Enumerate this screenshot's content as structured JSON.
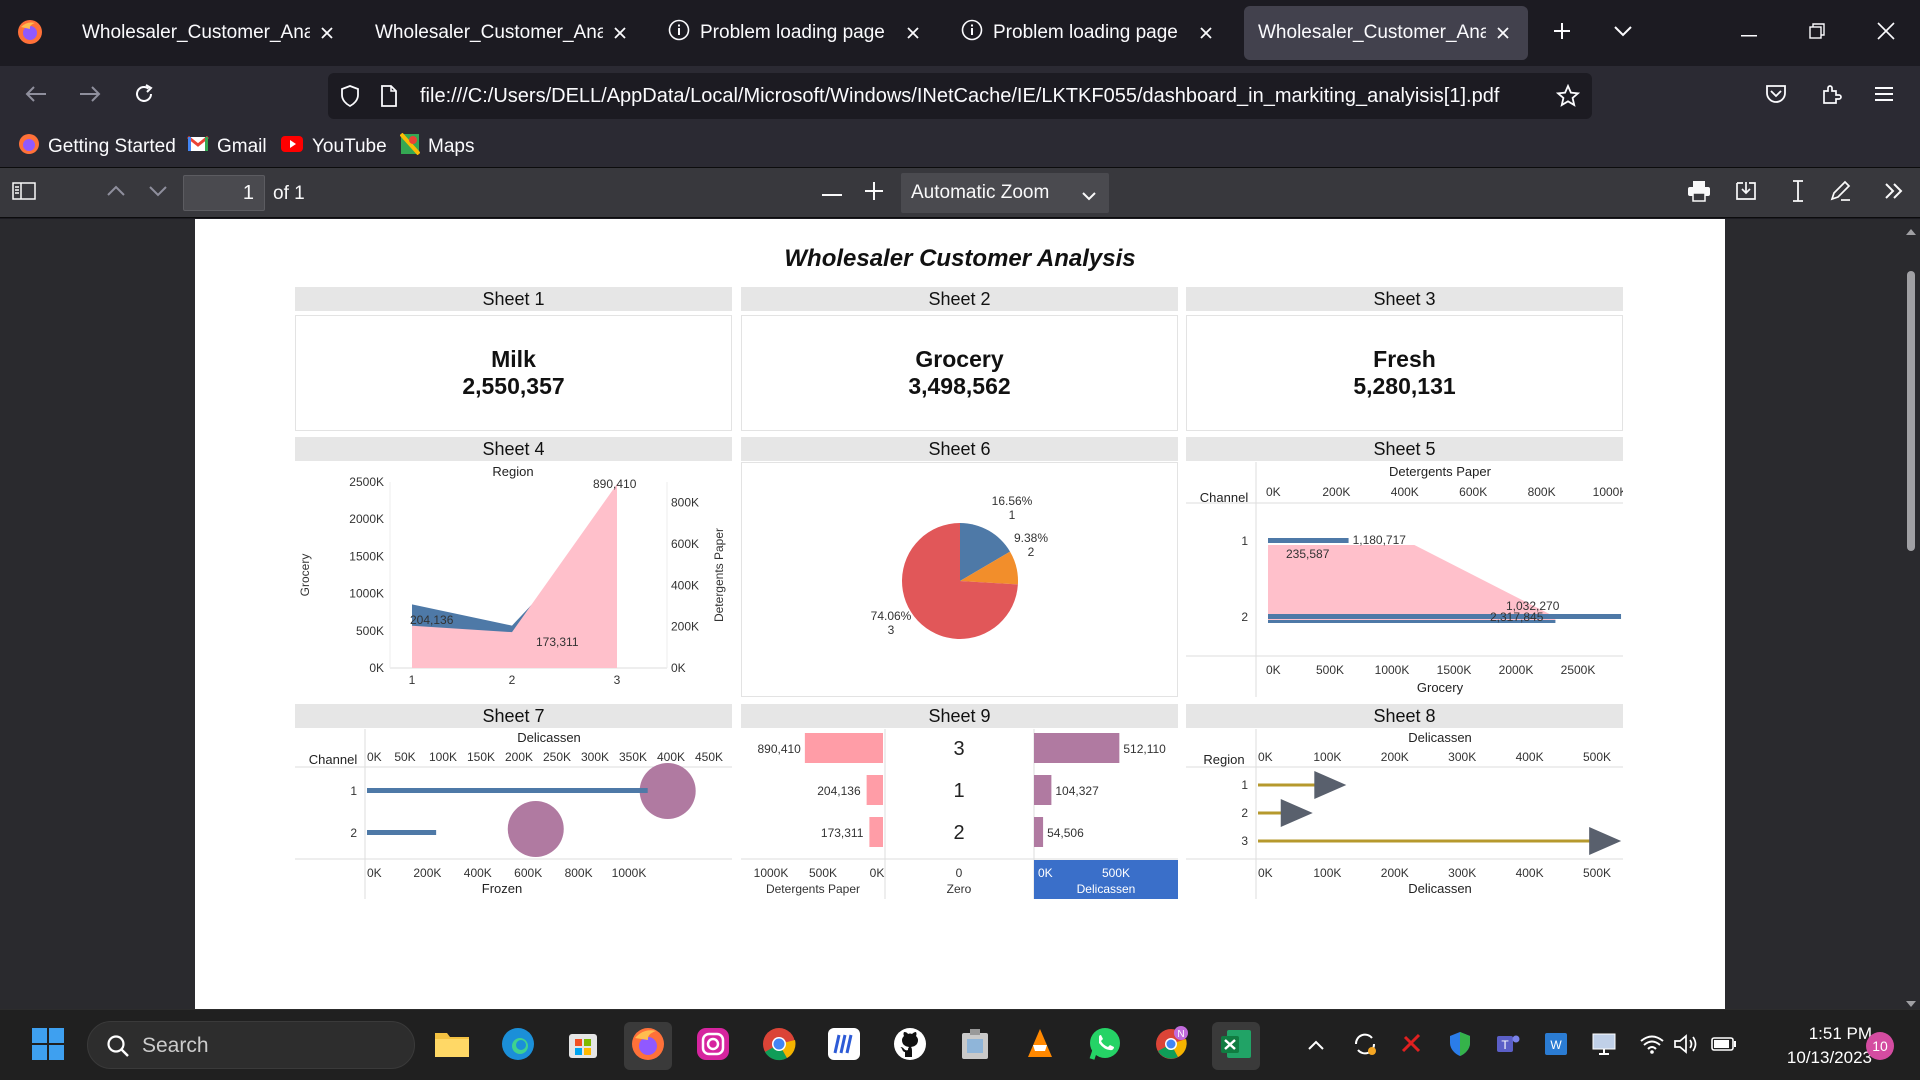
{
  "browser": {
    "tabs": [
      {
        "label": "Wholesaler_Customer_Analysis",
        "active": false,
        "type": "pdf"
      },
      {
        "label": "Wholesaler_Customer_Analysis",
        "active": false,
        "type": "pdf"
      },
      {
        "label": "Problem loading page",
        "active": false,
        "type": "error"
      },
      {
        "label": "Problem loading page",
        "active": false,
        "type": "error"
      },
      {
        "label": "Wholesaler_Customer_Analysis",
        "active": true,
        "type": "pdf"
      }
    ],
    "url": "file:///C:/Users/DELL/AppData/Local/Microsoft/Windows/INetCache/IE/LKTKF055/dashboard_in_markiting_analyisis[1].pdf",
    "bookmarks": [
      {
        "label": "Getting Started",
        "icon": "firefox-icon"
      },
      {
        "label": "Gmail",
        "icon": "gmail-icon"
      },
      {
        "label": "YouTube",
        "icon": "youtube-icon"
      },
      {
        "label": "Maps",
        "icon": "maps-icon"
      }
    ]
  },
  "pdf_toolbar": {
    "page_number": "1",
    "page_count": "of 1",
    "zoom": "Automatic Zoom"
  },
  "dashboard": {
    "title": "Wholesaler Customer Analysis",
    "sheet_headers": [
      "Sheet 1",
      "Sheet 2",
      "Sheet 3",
      "Sheet 4",
      "Sheet 6",
      "Sheet 5",
      "Sheet 7",
      "Sheet 9",
      "Sheet 8"
    ],
    "kpis": [
      {
        "label": "Milk",
        "value": "2,550,357"
      },
      {
        "label": "Grocery",
        "value": "3,498,562"
      },
      {
        "label": "Fresh",
        "value": "5,280,131"
      }
    ]
  },
  "chart_data": [
    {
      "id": "sheet4",
      "type": "area",
      "title": "Region",
      "x": [
        "1",
        "2",
        "3"
      ],
      "ylabel": "Grocery",
      "y2label": "Detergents Paper",
      "yticks": [
        "2500K",
        "2000K",
        "1500K",
        "1000K",
        "500K",
        "0K"
      ],
      "ylim": [
        0,
        2500000
      ],
      "y2ticks": [
        "800K",
        "600K",
        "400K",
        "200K",
        "0K"
      ],
      "y2lim": [
        0,
        900000
      ],
      "series": [
        {
          "name": "Grocery",
          "color": "#4e79a7",
          "values": [
            854833,
            570037,
            2072496
          ]
        },
        {
          "name": "Detergents Paper",
          "color": "#ffc0cb",
          "values": [
            204136,
            173311,
            890410
          ]
        }
      ],
      "labels": [
        "204,136",
        "173,311",
        "890,410"
      ]
    },
    {
      "id": "sheet6",
      "type": "pie",
      "slices": [
        {
          "region": "1",
          "percent": 16.56,
          "label": "16.56%",
          "color": "#4e79a7"
        },
        {
          "region": "2",
          "percent": 9.38,
          "label": "9.38%",
          "color": "#f28e2b"
        },
        {
          "region": "3",
          "percent": 74.06,
          "label": "74.06%",
          "color": "#e15759"
        }
      ]
    },
    {
      "id": "sheet5",
      "type": "bar",
      "toplabel": "Detergents Paper",
      "bottomlabel": "Grocery",
      "rowheader": "Channel",
      "categories": [
        "1",
        "2"
      ],
      "topticks": [
        "0K",
        "200K",
        "400K",
        "600K",
        "800K",
        "1000K"
      ],
      "bottomticks": [
        "0K",
        "500K",
        "1000K",
        "1500K",
        "2000K",
        "2500K"
      ],
      "detergents": [
        235587,
        1032270
      ],
      "grocery": [
        1180717,
        2317845
      ],
      "detergents_labels": [
        "235,587",
        "1,032,270"
      ],
      "grocery_labels": [
        "1,180,717",
        "2,317,845"
      ],
      "colors": {
        "detergents": "#ffc0cb",
        "grocery": "#4e79a7"
      }
    },
    {
      "id": "sheet7",
      "type": "bar",
      "toplabel": "Delicassen",
      "bottomlabel": "Frozen",
      "rowheader": "Channel",
      "categories": [
        "1",
        "2"
      ],
      "topticks": [
        "0K",
        "50K",
        "100K",
        "150K",
        "200K",
        "250K",
        "300K",
        "350K",
        "400K",
        "450K"
      ],
      "bottomticks": [
        "0K",
        "200K",
        "400K",
        "600K",
        "800K",
        "1000K"
      ],
      "frozen": [
        1116979,
        234671
      ],
      "delicassen": [
        421955,
        248346
      ],
      "colors": {
        "bar": "#4e79a7",
        "circle": "#b07aa1"
      }
    },
    {
      "id": "sheet9",
      "type": "bar",
      "leftlabel": "Detergents Paper",
      "midlabel": "Zero",
      "rightlabel": "Delicassen",
      "rows": [
        "3",
        "1",
        "2"
      ],
      "detergents": [
        890410,
        204136,
        173311
      ],
      "delicassen": [
        512110,
        104327,
        54506
      ],
      "detergents_labels": [
        "890,410",
        "204,136",
        "173,311"
      ],
      "delicassen_labels": [
        "512,110",
        "104,327",
        "54,506"
      ],
      "leftticks": [
        "1000K",
        "500K",
        "0K"
      ],
      "midtick": "0",
      "rightticks": [
        "0K",
        "500K"
      ],
      "colors": {
        "detergents": "#ff9da7",
        "delicassen": "#b07aa1"
      }
    },
    {
      "id": "sheet8",
      "type": "bar",
      "toplabel": "Delicassen",
      "bottomlabel": "Delicassen",
      "rowheader": "Region",
      "categories": [
        "1",
        "2",
        "3"
      ],
      "ticks": [
        "0K",
        "100K",
        "200K",
        "300K",
        "400K",
        "500K"
      ],
      "values": [
        104327,
        54506,
        512110
      ],
      "colors": {
        "line": "#b6992d",
        "marker": "#59606d"
      }
    }
  ],
  "taskbar": {
    "search_placeholder": "Search",
    "time": "1:51 PM",
    "date": "10/13/2023",
    "notification_count": "10"
  }
}
